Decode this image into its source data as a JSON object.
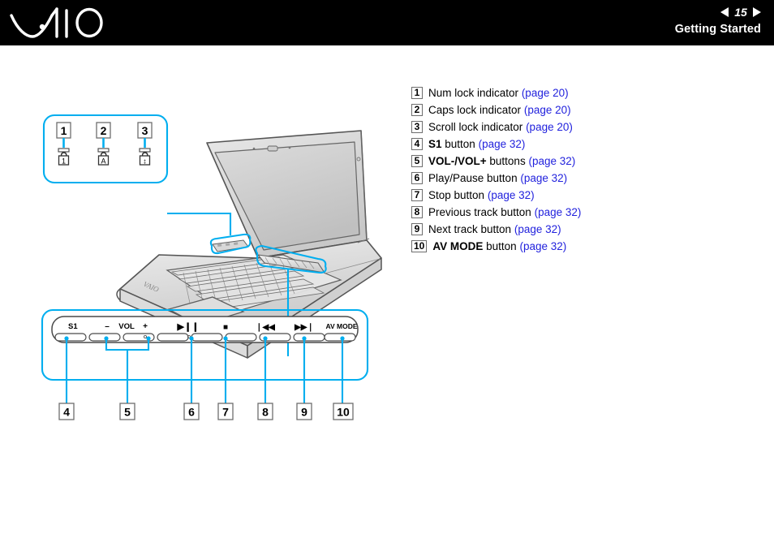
{
  "header": {
    "logo_alt": "VAIO",
    "page_number": "15",
    "prev_label": "◀",
    "next_label": "▶",
    "section_title": "Getting Started"
  },
  "colors": {
    "header_bg": "#000000",
    "header_text": "#ffffff",
    "page_ref_link": "#2222dd",
    "callout_accent": "#00aeef",
    "num_box_border": "#6e6e6e",
    "illustration_line": "#4d4d4d",
    "illustration_fill": "#d9d9d9"
  },
  "legend": {
    "items": [
      {
        "num": "1",
        "label_pre": "Num lock indicator",
        "label_bold": "",
        "label_post": "",
        "page_ref": "(page 20)"
      },
      {
        "num": "2",
        "label_pre": "Caps lock indicator",
        "label_bold": "",
        "label_post": "",
        "page_ref": "(page 20)"
      },
      {
        "num": "3",
        "label_pre": "Scroll lock indicator",
        "label_bold": "",
        "label_post": "",
        "page_ref": "(page 20)"
      },
      {
        "num": "4",
        "label_pre": "",
        "label_bold": "S1",
        "label_post": "button",
        "page_ref": "(page 32)"
      },
      {
        "num": "5",
        "label_pre": "",
        "label_bold": "VOL-/VOL+",
        "label_post": "buttons",
        "page_ref": "(page 32)"
      },
      {
        "num": "6",
        "label_pre": "Play/Pause button",
        "label_bold": "",
        "label_post": "",
        "page_ref": "(page 32)"
      },
      {
        "num": "7",
        "label_pre": "Stop button",
        "label_bold": "",
        "label_post": "",
        "page_ref": "(page 32)"
      },
      {
        "num": "8",
        "label_pre": "Previous track button",
        "label_bold": "",
        "label_post": "",
        "page_ref": "(page 32)"
      },
      {
        "num": "9",
        "label_pre": "Next track button",
        "label_bold": "",
        "label_post": "",
        "page_ref": "(page 32)"
      },
      {
        "num": "10",
        "label_pre": "",
        "label_bold": "AV MODE",
        "label_post": "button",
        "page_ref": "(page 32)"
      }
    ]
  },
  "indicator_callout": {
    "callouts": [
      {
        "num": "1",
        "icon": "padlock-num-lock-icon",
        "glyph": "1"
      },
      {
        "num": "2",
        "icon": "padlock-caps-lock-icon",
        "glyph": "A"
      },
      {
        "num": "3",
        "icon": "padlock-scroll-lock-icon",
        "glyph": "↕"
      }
    ]
  },
  "button_strip_callout": {
    "labels": {
      "s1": "S1",
      "vol_minus": "–",
      "vol": "VOL",
      "vol_plus": "+",
      "play_pause": "▶❙❙",
      "stop": "■",
      "prev_track": "❘◀◀",
      "next_track": "▶▶❘",
      "av_mode": "AV MODE"
    },
    "callouts": [
      "4",
      "5",
      "6",
      "7",
      "8",
      "9",
      "10"
    ]
  },
  "illustration": {
    "device_alt": "VAIO notebook computer, open, three-quarter view",
    "logo_text": "VAIO"
  }
}
